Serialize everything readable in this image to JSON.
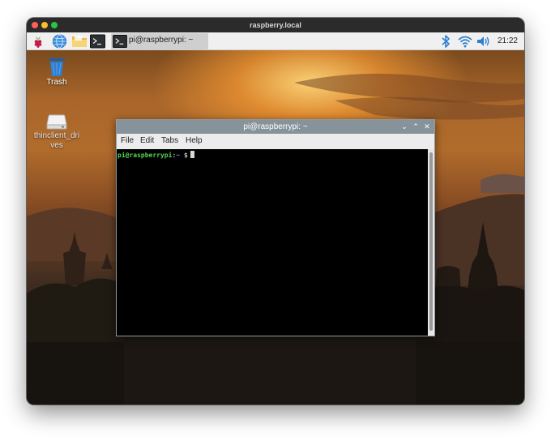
{
  "host_window": {
    "title": "raspberry.local"
  },
  "panel": {
    "menu_icon": "raspberry-menu-icon",
    "browser_icon": "globe-browser-icon",
    "files_icon": "file-manager-folder-icon",
    "terminal_icon": "terminal-icon",
    "active_task": {
      "icon": "terminal-icon",
      "label": "pi@raspberrypi: ~"
    },
    "tray": {
      "bluetooth_icon": "bluetooth-icon",
      "wifi_icon": "wifi-icon",
      "volume_icon": "volume-icon"
    },
    "clock": "21:22"
  },
  "desktop": {
    "icons": [
      {
        "label": "Trash",
        "icon": "trash-icon"
      },
      {
        "label": "thinclient_driv​es",
        "icon": "drive-icon"
      }
    ]
  },
  "terminal": {
    "title": "pi@raspberrypi: ~",
    "controls": {
      "minimize": "⌄",
      "maximize": "⌃",
      "close": "✕"
    },
    "menu": [
      "File",
      "Edit",
      "Tabs",
      "Help"
    ],
    "prompt": {
      "user_host": "pi@raspberrypi",
      "separator": ":",
      "path": "~",
      "symbol": " $"
    }
  },
  "colors": {
    "panel_bg": "#f0f0f0",
    "terminal_titlebar": "#87939b",
    "prompt_user": "#54d154",
    "prompt_path": "#6b8cff",
    "icon_blue": "#2f7fd0"
  }
}
